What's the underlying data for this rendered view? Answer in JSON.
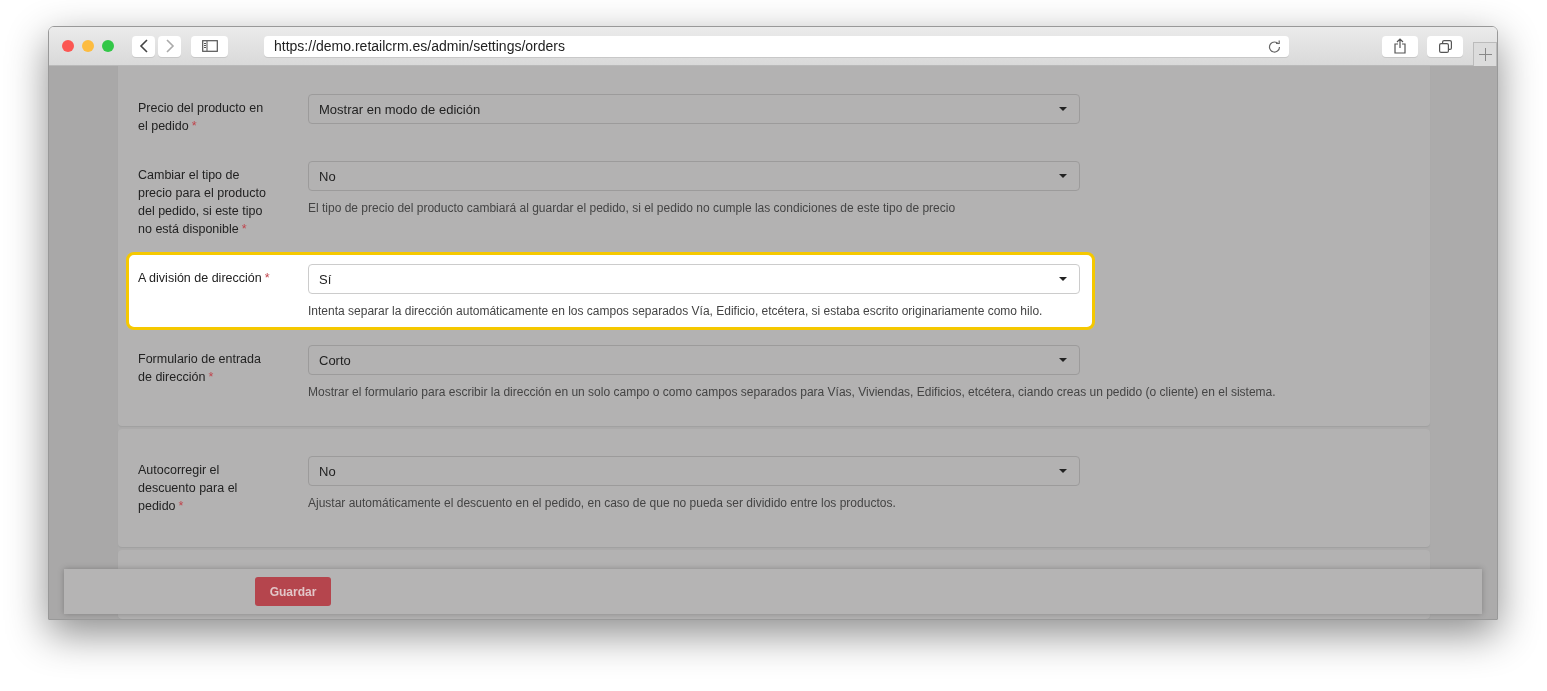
{
  "browser": {
    "url": "https://demo.retailcrm.es/admin/settings/orders"
  },
  "cards": [
    {
      "rows": [
        {
          "label": "Precio del producto en el pedido",
          "required": "*",
          "value": "Mostrar en modo de edición",
          "highlighted": false
        },
        {
          "label": "Cambiar el tipo de precio para el producto del pedido, si este tipo no está disponible",
          "required": "*",
          "value": "No",
          "hint": "El tipo de precio del producto cambiará al guardar el pedido, si el pedido no cumple las condiciones de este tipo de precio",
          "highlighted": false
        },
        {
          "label": "A división de dirección",
          "required": "*",
          "value": "Sí",
          "hint": "Intenta separar la dirección automáticamente en los campos separados Vía, Edificio, etcétera, si estaba escrito originariamente como hilo.",
          "highlighted": true
        },
        {
          "label": "Formulario de entrada de dirección",
          "required": "*",
          "value": "Corto",
          "hint": "Mostrar el formulario para escribir la dirección en un solo campo o como campos separados para Vías, Viviendas, Edificios, etcétera, ciando creas un pedido (o cliente) en el sistema.",
          "highlighted": false
        }
      ]
    },
    {
      "rows": [
        {
          "label": "Autocorregir el descuento para el pedido",
          "required": "*",
          "value": "No",
          "hint": "Ajustar automáticamente el descuento en el pedido, en caso de que no pueda ser dividido entre los productos.",
          "highlighted": false
        }
      ]
    }
  ],
  "footer": {
    "button": "Guardar"
  }
}
